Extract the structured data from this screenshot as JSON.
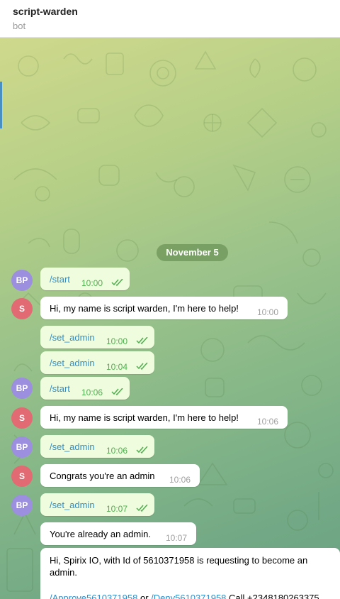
{
  "header": {
    "title": "script-warden",
    "subtitle": "bot"
  },
  "chat": {
    "date_label": "November 5",
    "messages": [
      {
        "avatar": "BP",
        "text": "/start",
        "time": "10:00"
      },
      {
        "avatar": "S",
        "text": "Hi, my name is script warden, I'm here to help!",
        "time": "10:00"
      },
      {
        "text": "/set_admin",
        "time": "10:00"
      },
      {
        "text": "/set_admin",
        "time": "10:04"
      },
      {
        "avatar": "BP",
        "text": "/start",
        "time": "10:06"
      },
      {
        "avatar": "S",
        "text": "Hi, my name is script warden, I'm here to help!",
        "time": "10:06"
      },
      {
        "avatar": "BP",
        "text": "/set_admin",
        "time": "10:06"
      },
      {
        "avatar": "S",
        "text": "Congrats you're an admin",
        "time": "10:06"
      },
      {
        "avatar": "BP",
        "text": "/set_admin",
        "time": "10:07"
      },
      {
        "text": "You're already an admin.",
        "time": "10:07"
      },
      {
        "text_line1": "Hi, Spirix IO, with Id of 5610371958 is requesting to become an",
        "text_line2": "admin.",
        "approve_link": "/Approve5610371958",
        "or_text": "or",
        "deny_link": "/Deny5610371958",
        "call_text": "Call +2348180263375"
      }
    ]
  },
  "colors": {
    "outgoing_bubble": "#effdde",
    "incoming_bubble": "#ffffff",
    "link": "#2f8dc9",
    "read_ticks": "#4fae4e",
    "avatar_bp": "#9c8fe0",
    "avatar_s": "#e26a72"
  },
  "icons": {
    "read_status": "double-check-icon"
  }
}
